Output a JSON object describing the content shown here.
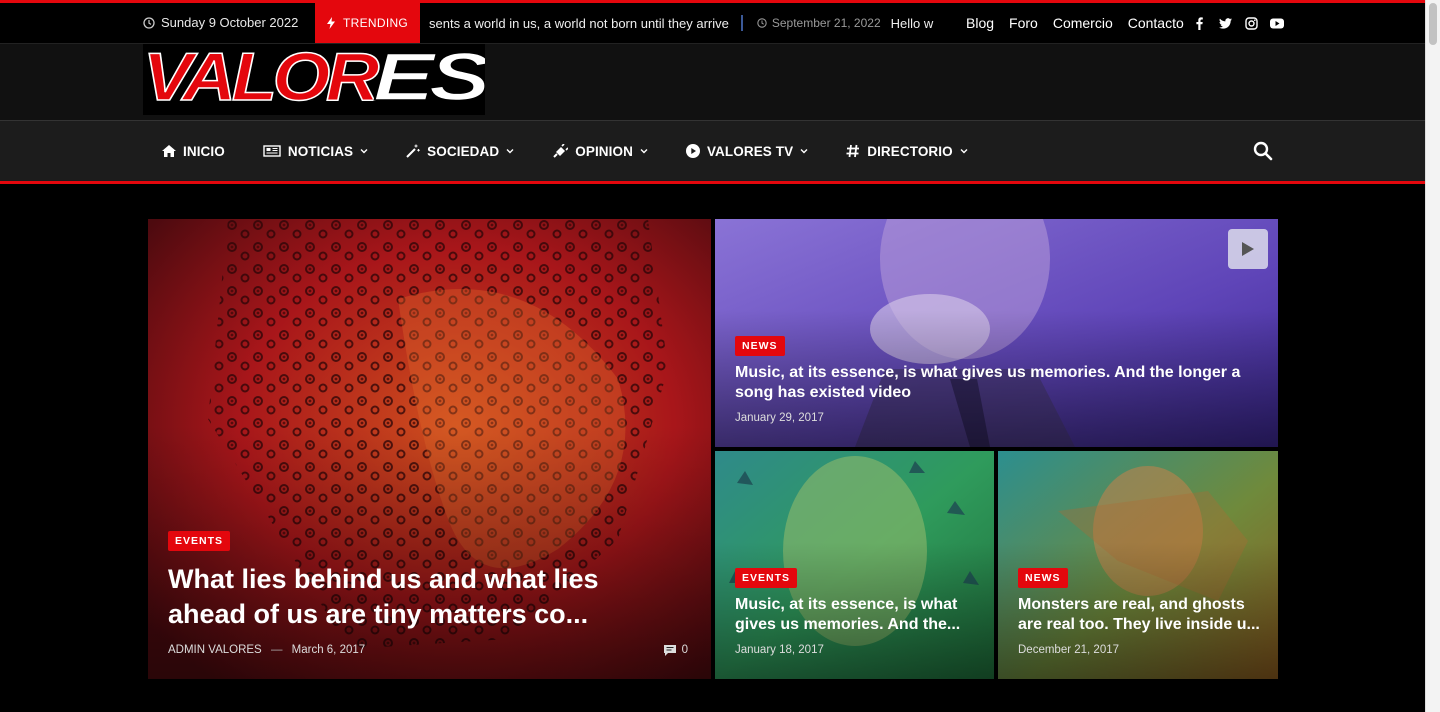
{
  "topbar": {
    "date": "Sunday 9 October 2022",
    "trending_label": "TRENDING",
    "ticker_text": "sents a world in us, a world not born until they arrive",
    "ticker_next_date": "September 21, 2022",
    "ticker_next_text": "Hello w",
    "menu": [
      "Blog",
      "Foro",
      "Comercio",
      "Contacto"
    ],
    "social_icons": [
      "facebook-icon",
      "twitter-icon",
      "instagram-icon",
      "youtube-icon"
    ]
  },
  "logo": {
    "text": "VALORES"
  },
  "nav": {
    "items": [
      {
        "label": "INICIO",
        "icon": "home-icon",
        "dropdown": false
      },
      {
        "label": "NOTICIAS",
        "icon": "newspaper-icon",
        "dropdown": true
      },
      {
        "label": "SOCIEDAD",
        "icon": "magic-wand-icon",
        "dropdown": true
      },
      {
        "label": "OPINION",
        "icon": "plug-icon",
        "dropdown": true
      },
      {
        "label": "VALORES TV",
        "icon": "play-circle-icon",
        "dropdown": true
      },
      {
        "label": "DIRECTORIO",
        "icon": "hashtag-icon",
        "dropdown": true
      }
    ]
  },
  "posts": {
    "main": {
      "category": "EVENTS",
      "title": "What lies behind us and what lies ahead of us are tiny matters co...",
      "author": "ADMIN VALORES",
      "separator": "—",
      "date": "March 6, 2017",
      "comments": "0"
    },
    "top_right": {
      "category": "NEWS",
      "title": "Music, at its essence, is what gives us memories. And the longer a song has existed video",
      "date": "January 29, 2017"
    },
    "bottom_left": {
      "category": "EVENTS",
      "title": "Music, at its essence, is what gives us memories. And the...",
      "date": "January 18, 2017"
    },
    "bottom_right": {
      "category": "NEWS",
      "title": "Monsters are real, and ghosts are real too. They live inside u...",
      "date": "December 21, 2017"
    }
  },
  "colors": {
    "accent": "#e4070d",
    "background": "#000000",
    "nav_bg": "#1c1c1c"
  }
}
